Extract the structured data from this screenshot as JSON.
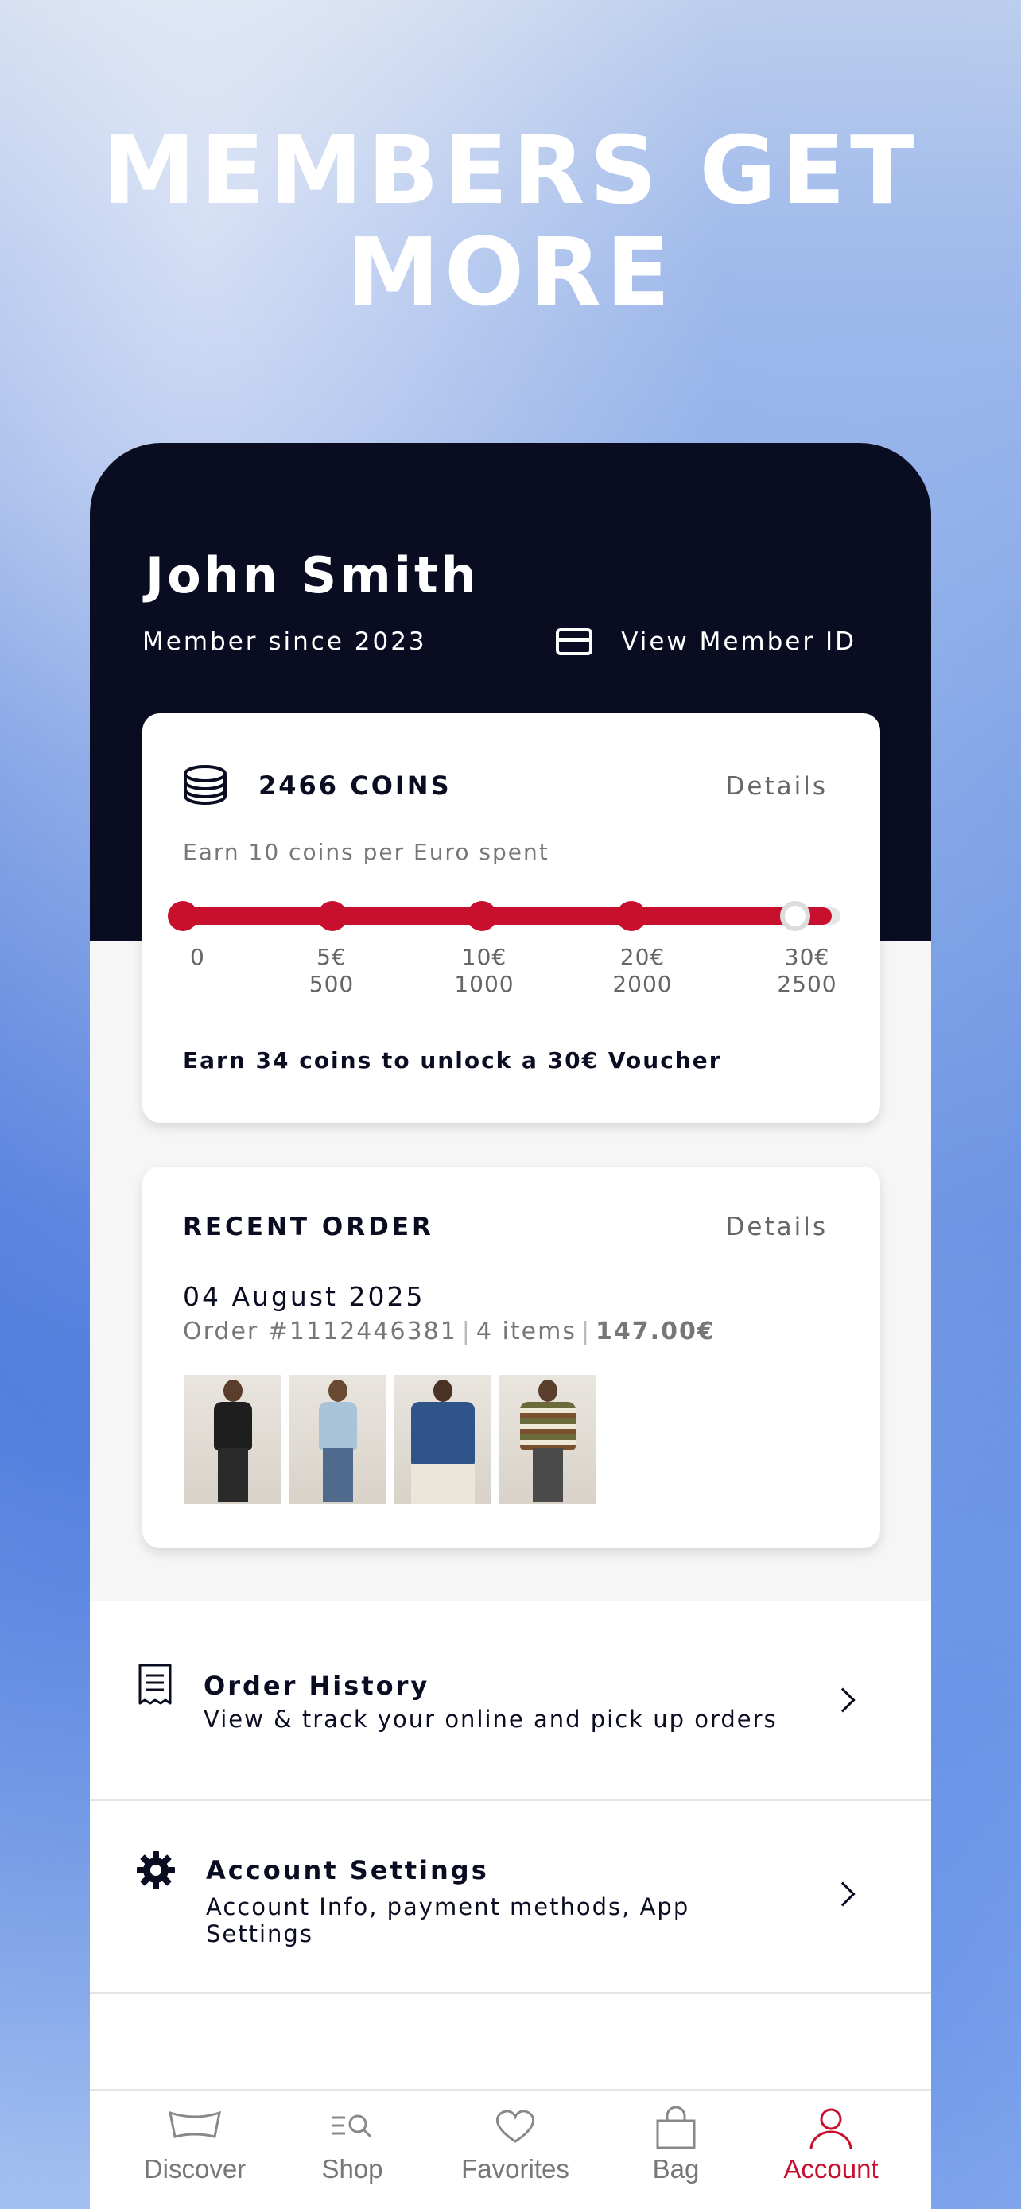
{
  "hero": {
    "line1": "MEMBERS GET",
    "line2": "MORE"
  },
  "member": {
    "name": "John Smith",
    "since": "Member since 2023",
    "view_id_label": "View Member ID"
  },
  "coins": {
    "title": "2466 COINS",
    "details_label": "Details",
    "subtitle": "Earn 10 coins per Euro spent",
    "progress_fraction": 0.9864,
    "milestones": [
      {
        "reward": "0",
        "coins": ""
      },
      {
        "reward": "5€",
        "coins": "500"
      },
      {
        "reward": "10€",
        "coins": "1000"
      },
      {
        "reward": "20€",
        "coins": "2000"
      },
      {
        "reward": "30€",
        "coins": "2500"
      }
    ],
    "cta": "Earn 34 coins to unlock a 30€ Voucher"
  },
  "recent_order": {
    "title": "RECENT ORDER",
    "details_label": "Details",
    "date": "04 August 2025",
    "order_number": "Order #1112446381",
    "items": "4 items",
    "total": "147.00€"
  },
  "menu": {
    "order_history": {
      "title": "Order History",
      "subtitle": "View & track your online and pick up orders"
    },
    "account_settings": {
      "title": "Account Settings",
      "subtitle": "Account Info, payment methods, App Settings"
    }
  },
  "tabs": [
    {
      "label": "Discover",
      "icon": "jeans-tag-icon"
    },
    {
      "label": "Shop",
      "icon": "search-list-icon"
    },
    {
      "label": "Favorites",
      "icon": "heart-icon"
    },
    {
      "label": "Bag",
      "icon": "bag-icon"
    },
    {
      "label": "Account",
      "icon": "person-icon"
    }
  ],
  "colors": {
    "accent": "#c8102e",
    "dark": "#0a0c22"
  }
}
